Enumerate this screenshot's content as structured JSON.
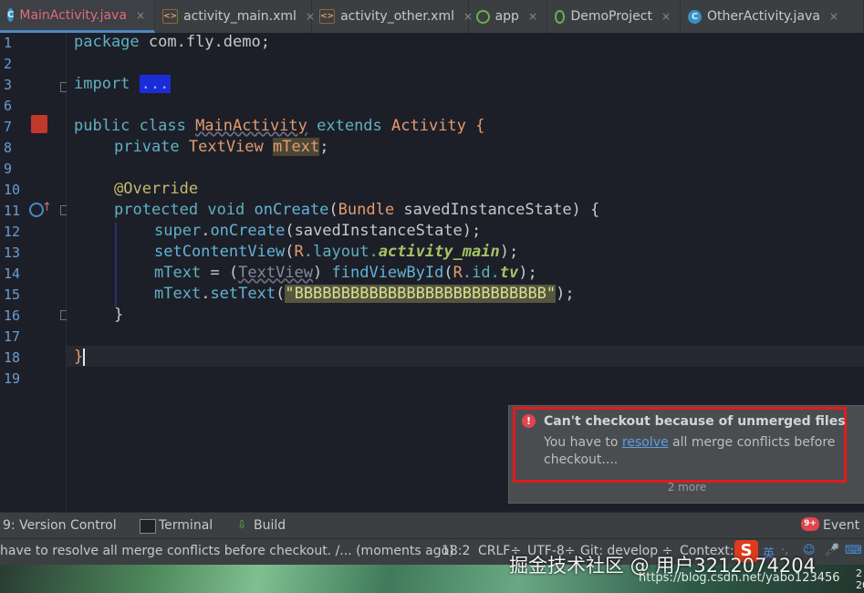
{
  "tabs": [
    {
      "label": "MainActivity.java",
      "icon": "java-class-icon",
      "active": true
    },
    {
      "label": "activity_main.xml",
      "icon": "xml-file-icon"
    },
    {
      "label": "activity_other.xml",
      "icon": "xml-file-icon"
    },
    {
      "label": "app",
      "icon": "module-icon"
    },
    {
      "label": "DemoProject",
      "icon": "module-icon"
    },
    {
      "label": "OtherActivity.java",
      "icon": "java-class-icon"
    }
  ],
  "tab_close_glyph": "×",
  "line_numbers": [
    "1",
    "2",
    "3",
    "6",
    "7",
    "8",
    "9",
    "10",
    "11",
    "12",
    "13",
    "14",
    "15",
    "16",
    "17",
    "18",
    "19"
  ],
  "code": {
    "package_kw": "package",
    "package_name": " com.fly.demo;",
    "import_kw": "import",
    "import_folded": "...",
    "l7_public": "public class ",
    "l7_class": "MainActivity",
    "l7_extends": " extends ",
    "l7_activity": "Activity {",
    "l8_private": "private ",
    "l8_type": "TextView ",
    "l8_field": "mText",
    "l8_semi": ";",
    "l10_annotation": "@Override",
    "l11_mods": "protected void ",
    "l11_method": "onCreate",
    "l11_paren": "(",
    "l11_bundle": "Bundle",
    "l11_rest": " savedInstanceState) {",
    "l12_super": "super",
    "l12_dot": ".",
    "l12_call": "onCreate",
    "l12_rest": "(savedInstanceState);",
    "l13_call": "setContentView",
    "l13_p": "(",
    "l13_r": "R",
    "l13_layout": ".layout.",
    "l13_main": "activity_main",
    "l13_end": ");",
    "l14_m": "mText",
    "l14_eq": " = (",
    "l14_cast": "TextView",
    "l14_close": ") ",
    "l14_call": "findViewById",
    "l14_p": "(",
    "l14_r": "R",
    "l14_id": ".id.",
    "l14_tv": "tv",
    "l14_end": ");",
    "l15_m": "mText",
    "l15_dot": ".",
    "l15_call": "setText",
    "l15_p": "(",
    "l15_str": "\"BBBBBBBBBBBBBBBBBBBBBBBBBBB\"",
    "l15_end": ");",
    "l16_brace": "}",
    "l18_brace": "}"
  },
  "notification": {
    "title": "Can't checkout because of unmerged files",
    "body_prefix": "You have to ",
    "link": "resolve",
    "body_suffix": " all merge conflicts before checkout....",
    "more": "2 more"
  },
  "toolbar": {
    "version_control": "9: Version Control",
    "terminal": "Terminal",
    "build": "Build",
    "event_log": "Event L",
    "event_badge": "9+"
  },
  "status": {
    "message": "have to resolve all merge conflicts before checkout. /... (moments ago)",
    "position": "18:2",
    "line_sep": "CRLF÷",
    "encoding": "UTF-8÷",
    "branch": "Git: develop ÷",
    "context": "Context:"
  },
  "watermark": {
    "main": "掘金技术社区 @ 用户3212074204",
    "url": "https://blog.csdn.net/yabo123456",
    "clock_fragment": "2 20"
  },
  "ime": {
    "logo": "S",
    "tray_items": [
      "英",
      "·,",
      "☺",
      "🎤",
      "⌨"
    ]
  },
  "colors": {
    "accent": "#4a88c7",
    "error": "#e21b1b",
    "editor_bg": "#1d1f28"
  }
}
